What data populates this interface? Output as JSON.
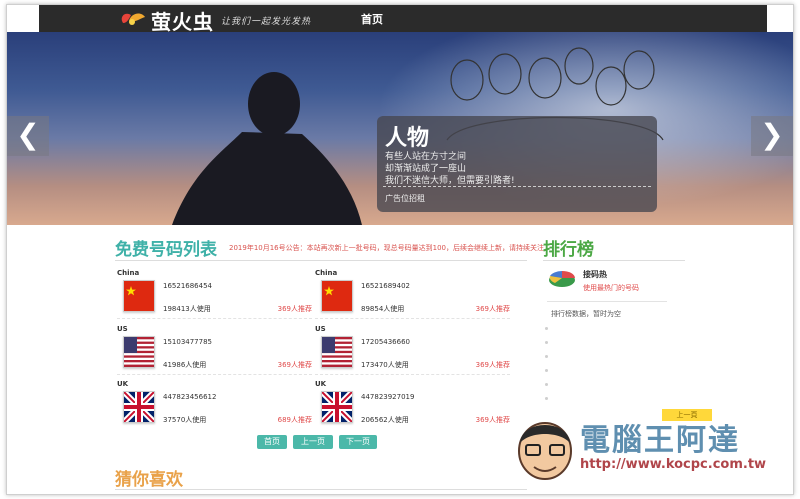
{
  "site": {
    "logo_text": "萤火虫",
    "slogan": "让我们一起发光发热",
    "nav_home": "首页"
  },
  "banner": {
    "prev": "❮",
    "next": "❯",
    "title": "人物",
    "lines": [
      "有些人站在方寸之间",
      "却渐渐站成了一座山",
      "我们不迷信大师，但需要引路者!"
    ],
    "ad": "广告位招租"
  },
  "numbers": {
    "title": "免费号码列表",
    "notice": "2019年10月16号公告：本站再次新上一批号码，现总号码量达到100，后续会继续上新，请持续关注",
    "items": [
      {
        "country": "China",
        "phone": "16521686454",
        "users": "198413人使用",
        "rec": "369人推荐",
        "flag": "cn"
      },
      {
        "country": "China",
        "phone": "16521689402",
        "users": "89854人使用",
        "rec": "369人推荐",
        "flag": "cn"
      },
      {
        "country": "US",
        "phone": "15103477785",
        "users": "41986人使用",
        "rec": "369人推荐",
        "flag": "us"
      },
      {
        "country": "US",
        "phone": "17205436660",
        "users": "173470人使用",
        "rec": "369人推荐",
        "flag": "us"
      },
      {
        "country": "UK",
        "phone": "447823456612",
        "users": "37570人使用",
        "rec": "689人推荐",
        "flag": "uk"
      },
      {
        "country": "UK",
        "phone": "447823927019",
        "users": "206562人使用",
        "rec": "369人推荐",
        "flag": "uk"
      }
    ],
    "pager": {
      "first": "首页",
      "prev": "上一页",
      "next": "下一页"
    }
  },
  "guess": {
    "title": "猜你喜欢"
  },
  "ranking": {
    "title": "排行榜",
    "hot_title": "接码热",
    "hot_desc": "使用最热门的号码",
    "empty": "排行榜数据，暂时为空"
  },
  "watermark": {
    "text": "電腦王阿達",
    "url": "http://www.kocpc.com.tw",
    "badge": "上一頁"
  }
}
